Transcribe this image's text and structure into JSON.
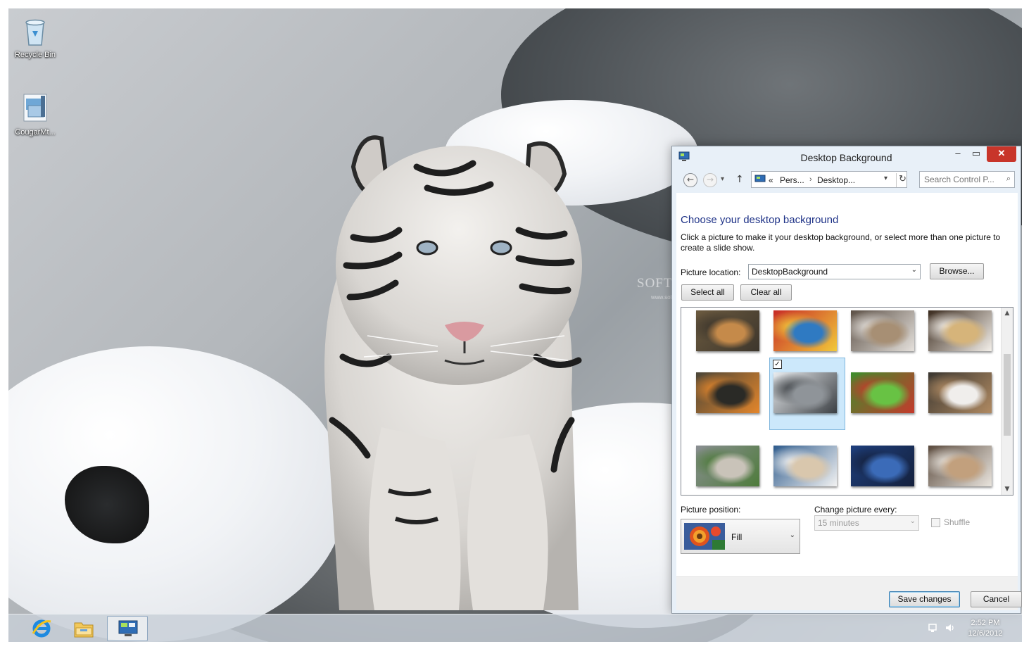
{
  "desktop": {
    "icons": [
      {
        "label": "Recycle Bin",
        "icon": "recycle-bin-icon"
      },
      {
        "label": "CougarMt...",
        "icon": "theme-file-icon"
      }
    ],
    "watermark": "SOFTP",
    "watermark_sub": "www.softpedia.com"
  },
  "window": {
    "title": "Desktop Background",
    "icon": "control-panel-icon",
    "controls": {
      "minimize": "–",
      "maximize": "▭",
      "close": "✕"
    },
    "nav": {
      "back": "←",
      "forward": "→",
      "recent": "▾",
      "up": "↑",
      "breadcrumb": [
        "«",
        "Pers...",
        "›",
        "Desktop..."
      ],
      "refresh": "↻",
      "dropdown": "▾",
      "search_placeholder": "Search Control P...",
      "search_icon": "⌕"
    },
    "heading": "Choose your desktop background",
    "description": "Click a picture to make it your desktop background, or select more than one picture to create a slide show.",
    "picture_location_label": "Picture location:",
    "picture_location_value": "DesktopBackground",
    "browse_label": "Browse...",
    "select_all_label": "Select all",
    "clear_all_label": "Clear all",
    "gallery": {
      "selected_index": 5,
      "checked_mark": "✓",
      "thumbnails": [
        {
          "subject": "tiger-cub",
          "colors": [
            "#6b5a3f",
            "#c58a4a",
            "#3d362c"
          ]
        },
        {
          "subject": "macaw",
          "colors": [
            "#c72b27",
            "#2f7ac2",
            "#f2c93a"
          ]
        },
        {
          "subject": "cougar-head",
          "colors": [
            "#5c5046",
            "#a78f74",
            "#e5e1dc"
          ]
        },
        {
          "subject": "crowned-crane",
          "colors": [
            "#3a2a1d",
            "#d6b47a",
            "#f4f0ea"
          ]
        },
        {
          "subject": "deer",
          "colors": [
            "#4a4538",
            "#2a2a26",
            "#e4862b"
          ]
        },
        {
          "subject": "white-tiger",
          "colors": [
            "#e9ecef",
            "#8f9499",
            "#3b3f43"
          ]
        },
        {
          "subject": "parrot-green",
          "colors": [
            "#3c8e2c",
            "#68c244",
            "#c53a2c"
          ]
        },
        {
          "subject": "cougar-snow",
          "colors": [
            "#3a3630",
            "#f0eeec",
            "#b08a62"
          ]
        },
        {
          "subject": "kangaroo",
          "colors": [
            "#8b8f93",
            "#c9c3b9",
            "#4d7b3a"
          ]
        },
        {
          "subject": "lynx",
          "colors": [
            "#2e5b8c",
            "#d9c7ad",
            "#f2f2f2"
          ]
        },
        {
          "subject": "blue-macaw",
          "colors": [
            "#1e3f7d",
            "#3b6bb8",
            "#15213d"
          ]
        },
        {
          "subject": "cougar-cub",
          "colors": [
            "#5a4a3d",
            "#c2a07d",
            "#e9e4dd"
          ]
        }
      ]
    },
    "picture_position_label": "Picture position:",
    "picture_position_value": "Fill",
    "change_every_label": "Change picture every:",
    "change_every_value": "15 minutes",
    "shuffle_label": "Shuffle",
    "save_label": "Save changes",
    "cancel_label": "Cancel"
  },
  "taskbar": {
    "apps": [
      {
        "name": "internet-explorer-icon",
        "active": false
      },
      {
        "name": "file-explorer-icon",
        "active": false
      },
      {
        "name": "control-panel-icon",
        "active": true
      }
    ],
    "time": "2:52 PM",
    "date": "12/6/2012"
  }
}
